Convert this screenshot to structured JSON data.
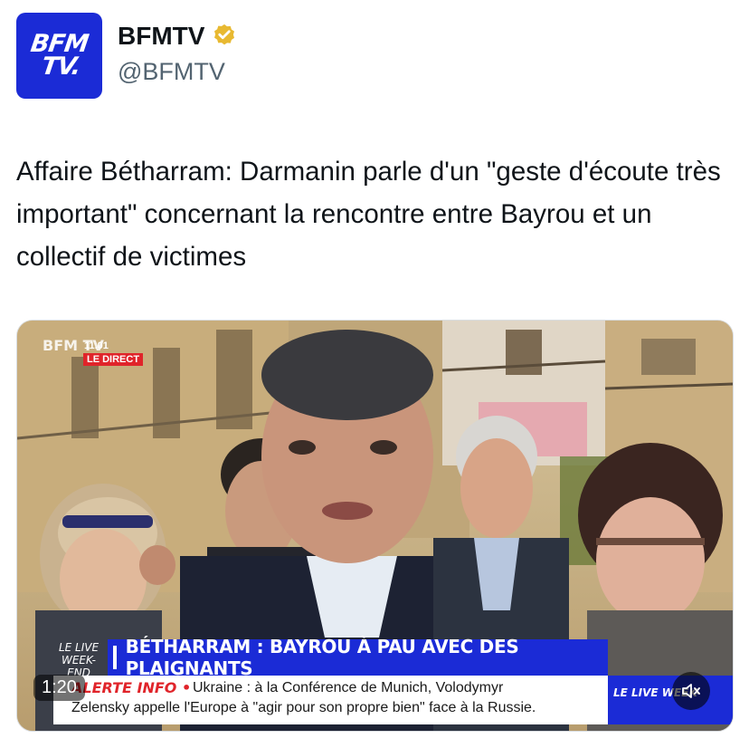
{
  "account": {
    "avatar_line1": "BFM",
    "avatar_line2": "TV.",
    "display_name": "BFMTV",
    "handle": "@BFMTV",
    "badge_icon": "verified-badge-icon",
    "badge_color": "#e8b931"
  },
  "tweet": {
    "text": "Affaire Bétharram: Darmanin parle d'un \"geste d'écoute très important\" concernant la rencontre entre Bayrou et un collectif de victimes"
  },
  "video": {
    "corner_logo": "BFM TV",
    "clock": "11.01",
    "live_label": "LE DIRECT",
    "weekend_label": "LE LIVE WEEK-END",
    "headline": "BÉTHARRAM : BAYROU À PAU AVEC DES PLAIGNANTS",
    "ticker_label": "ALERTE INFO •",
    "ticker_line1": "Ukraine : à la Conférence de Munich, Volodymyr",
    "ticker_line2": "Zelensky appelle l'Europe à \"agir pour son propre bien\" face à la Russie.",
    "right_tag": "LE LIVE WEEK-",
    "timer": "1:20",
    "mute_icon": "speaker-muted-icon",
    "brand_blue": "#1b2bd6",
    "alert_red": "#e0242a"
  }
}
